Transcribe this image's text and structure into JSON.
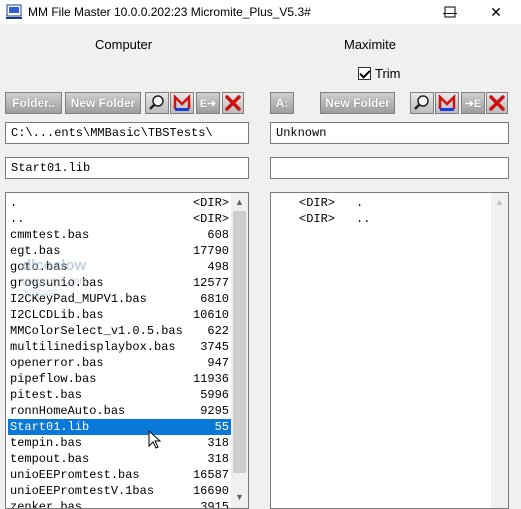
{
  "titlebar": {
    "title": "MM File Master  10.0.0.202:23  Micromite_Plus_V5.3#",
    "minimize": "—",
    "maximize": "☐",
    "close": "✕"
  },
  "left": {
    "label": "Computer",
    "folder_btn": "Folder..",
    "newfolder_btn": "New Folder",
    "transfer_btn": "E➔",
    "path": "C:\\...ents\\MMBasic\\TBSTests\\",
    "filename": "Start01.lib",
    "files": [
      {
        "name": ".",
        "size": "<DIR>"
      },
      {
        "name": "..",
        "size": "<DIR>"
      },
      {
        "name": "cmmtest.bas",
        "size": "608"
      },
      {
        "name": "egt.bas",
        "size": "17790"
      },
      {
        "name": "goto.bas",
        "size": "498"
      },
      {
        "name": "grogsunio.bas",
        "size": "12577"
      },
      {
        "name": "I2CKeyPad_MUPV1.bas",
        "size": "6810"
      },
      {
        "name": "I2CLCDLib.bas",
        "size": "10610"
      },
      {
        "name": "MMColorSelect_v1.0.5.bas",
        "size": "622"
      },
      {
        "name": "multilinedisplaybox.bas",
        "size": "3745"
      },
      {
        "name": "openerror.bas",
        "size": "947"
      },
      {
        "name": "pipeflow.bas",
        "size": "11936"
      },
      {
        "name": "pitest.bas",
        "size": "5996"
      },
      {
        "name": "ronnHomeAuto.bas",
        "size": "9295"
      },
      {
        "name": "Start01.lib",
        "size": "55"
      },
      {
        "name": "tempin.bas",
        "size": "318"
      },
      {
        "name": "tempout.bas",
        "size": "318"
      },
      {
        "name": "unioEEPromtest.bas",
        "size": "16587"
      },
      {
        "name": "unioEEPromtestV.1bas",
        "size": "16690"
      },
      {
        "name": "zenker.bas",
        "size": "3915"
      }
    ],
    "selected_index": 14
  },
  "right": {
    "label": "Maximite",
    "trim_label": "Trim",
    "trim_checked": true,
    "drive_btn": "A:",
    "newfolder_btn": "New Folder",
    "transfer_btn": "➔E",
    "path": "Unknown",
    "filename": "",
    "files": [
      {
        "name": ".",
        "size": "<DIR>"
      },
      {
        "name": "..",
        "size": "<DIR>"
      }
    ]
  },
  "watermark": {
    "line1": "dlcoslow",
    "line2": "grogsunio.com",
    "line3": "2018/4/26"
  },
  "colors": {
    "selection": "#0a78d7",
    "delete_red": "#d01010",
    "text_black": "#000000"
  }
}
